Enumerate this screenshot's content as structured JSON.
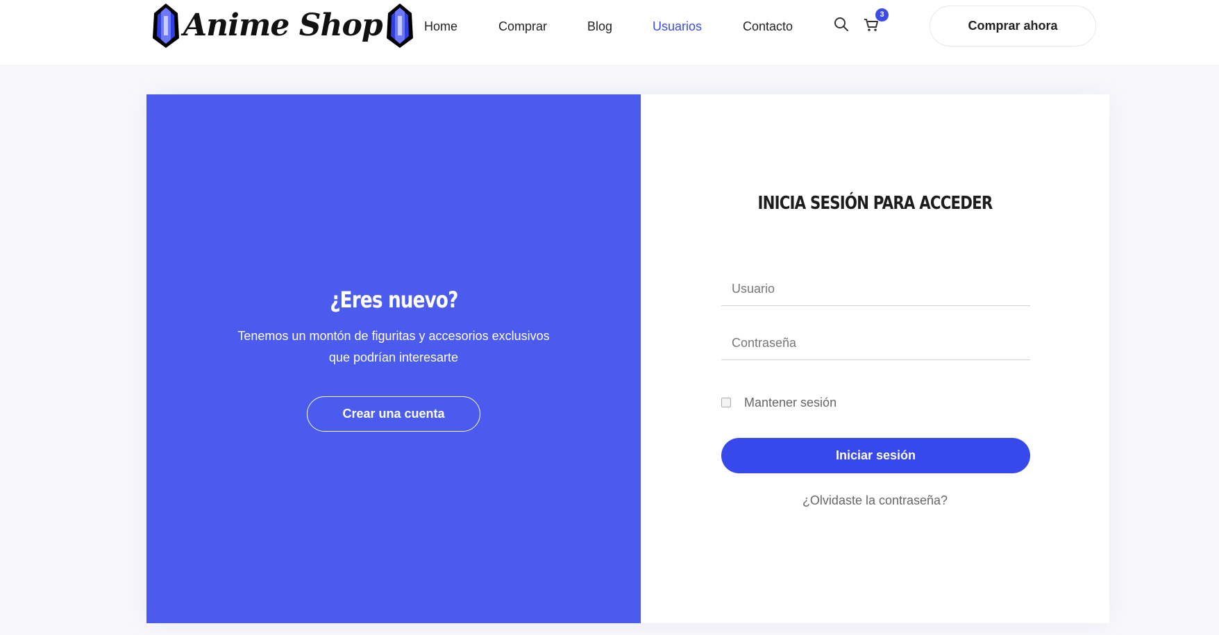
{
  "brand": {
    "logo_text": "Anime Shop",
    "accent_color": "#3a4be8",
    "panel_color": "#4a5bed"
  },
  "nav": {
    "items": [
      {
        "label": "Home",
        "active": false
      },
      {
        "label": "Comprar",
        "active": false
      },
      {
        "label": "Blog",
        "active": false
      },
      {
        "label": "Usuarios",
        "active": true
      },
      {
        "label": "Contacto",
        "active": false
      }
    ],
    "search_icon": "search-icon",
    "cart_icon": "cart-icon",
    "cart_count": "3",
    "cta_label": "Comprar ahora"
  },
  "signup": {
    "title": "¿Eres nuevo?",
    "text_line1": "Tenemos un montón de figuritas y accesorios exclusivos",
    "text_line2": "que podrían interesarte",
    "button_label": "Crear una cuenta"
  },
  "login": {
    "title": "INICIA SESIÓN PARA ACCEDER",
    "username_placeholder": "Usuario",
    "password_placeholder": "Contraseña",
    "remember_label": "Mantener sesión",
    "remember_checked": false,
    "submit_label": "Iniciar sesión",
    "forgot_label": "¿Olvidaste la contraseña?"
  }
}
